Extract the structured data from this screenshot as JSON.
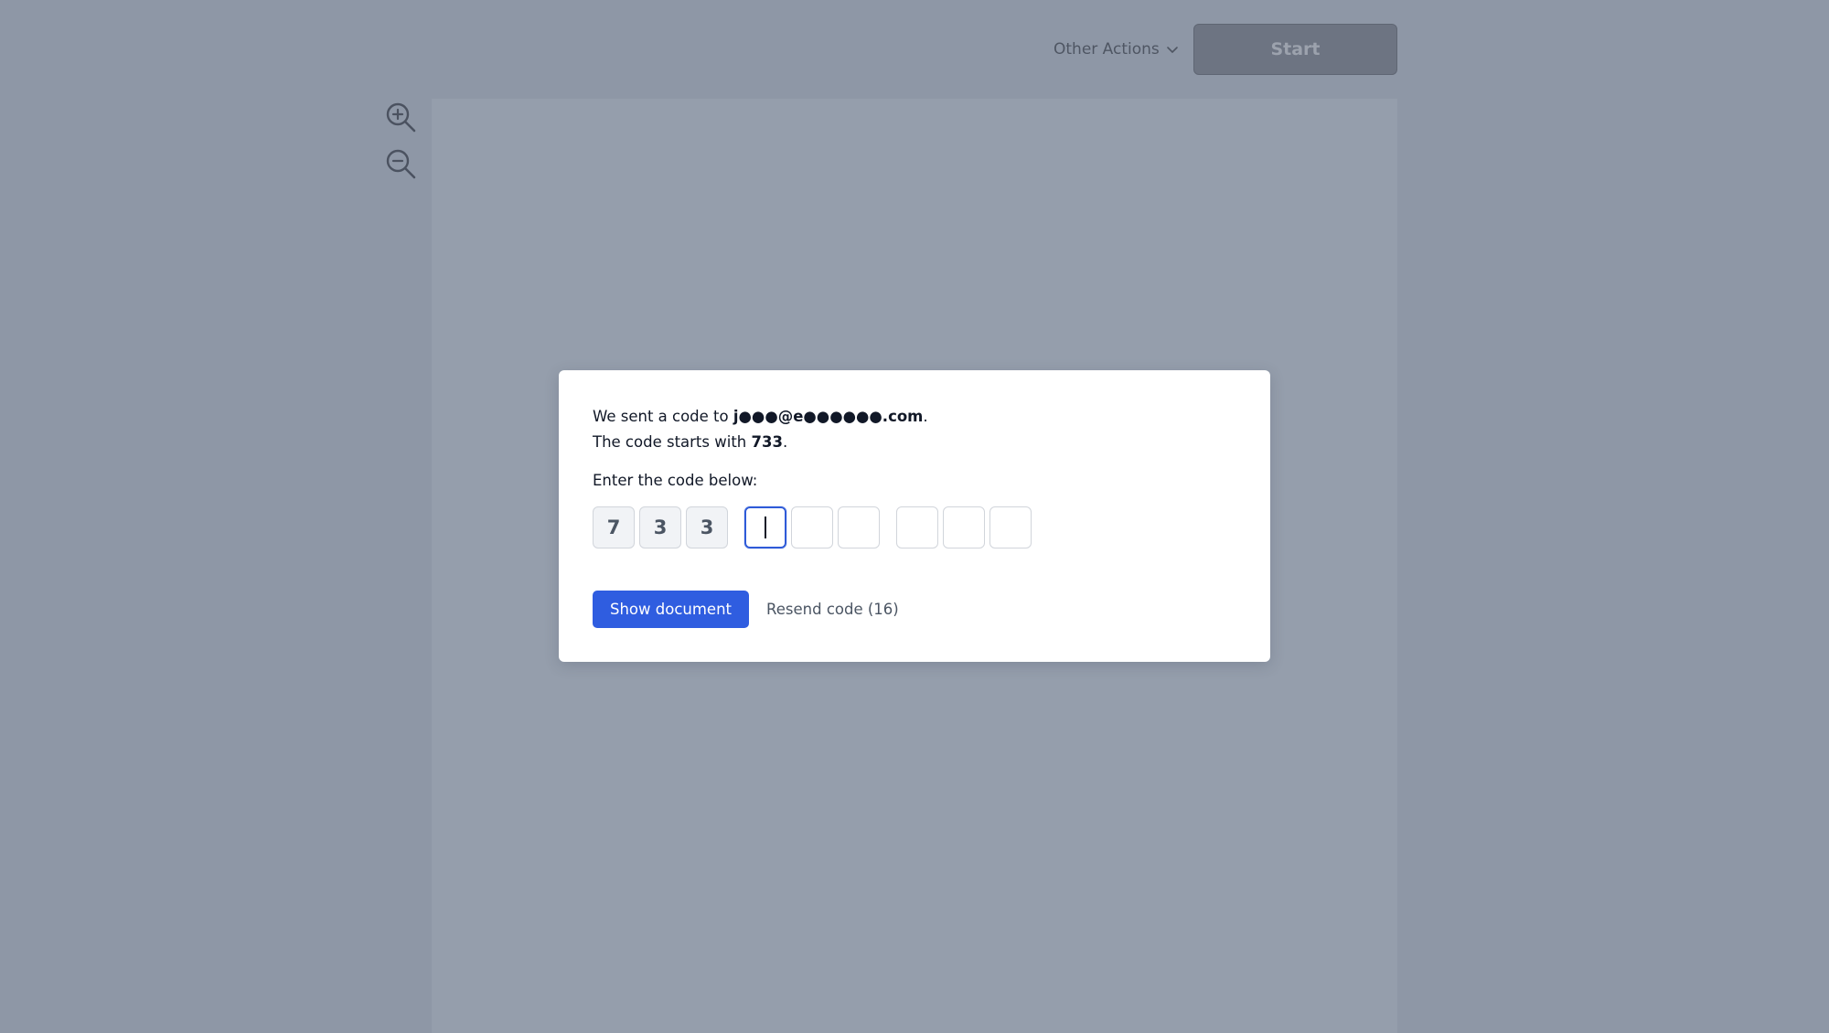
{
  "header": {
    "other_actions_label": "Other Actions",
    "start_label": "Start"
  },
  "toolbar": {
    "zoom_in_icon": "zoom-in-icon",
    "zoom_out_icon": "zoom-out-icon"
  },
  "modal": {
    "sent_prefix": "We sent a code to ",
    "email": "j●●●@e●●●●●●.com",
    "sent_suffix": ".",
    "starts_prefix": "The code starts with ",
    "code_prefix": "733",
    "starts_suffix": ".",
    "prompt": "Enter the code below:",
    "digits": [
      "7",
      "3",
      "3",
      "",
      "",
      "",
      "",
      "",
      ""
    ],
    "show_document_label": "Show document",
    "resend_label": "Resend code (16)"
  },
  "colors": {
    "backdrop": "#8e97a6",
    "primary": "#2f5de0",
    "active_border": "#2f5bd8"
  }
}
